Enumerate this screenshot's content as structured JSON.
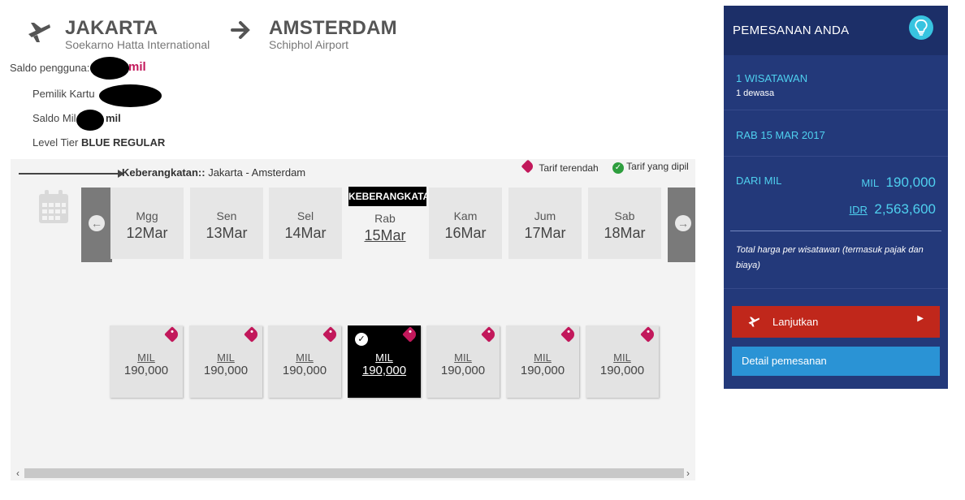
{
  "route": {
    "origin_city": "JAKARTA",
    "origin_airport": "Soekarno Hatta International",
    "dest_city": "AMSTERDAM",
    "dest_airport": "Schiphol Airport"
  },
  "user": {
    "saldo_label": "Saldo pengguna:",
    "saldo_unit": "mil",
    "card_owner_label": "Pemilik Kartu",
    "miles_label": "Saldo Mil",
    "miles_unit": "mil",
    "tier_label": "Level Tier",
    "tier_value": "BLUE REGULAR"
  },
  "panel": {
    "direction_label": "Keberangkatan::",
    "direction_route": "Jakarta - Amsterdam",
    "legend_lowest": "Tarif terendah",
    "legend_selected": "Tarif yang dipil",
    "tooltip": "KEBERANGKATAN",
    "days": [
      {
        "name": "Mgg",
        "date": "12Mar"
      },
      {
        "name": "Sen",
        "date": "13Mar"
      },
      {
        "name": "Sel",
        "date": "14Mar"
      },
      {
        "name": "Rab",
        "date": "15Mar"
      },
      {
        "name": "Kam",
        "date": "16Mar"
      },
      {
        "name": "Jum",
        "date": "17Mar"
      },
      {
        "name": "Sab",
        "date": "18Mar"
      }
    ],
    "fares": [
      {
        "currency": "MIL",
        "amount": "190,000"
      },
      {
        "currency": "MIL",
        "amount": "190,000"
      },
      {
        "currency": "MIL",
        "amount": "190,000"
      },
      {
        "currency": "MIL",
        "amount": "190,000"
      },
      {
        "currency": "MIL",
        "amount": "190,000"
      },
      {
        "currency": "MIL",
        "amount": "190,000"
      },
      {
        "currency": "MIL",
        "amount": "190,000"
      }
    ],
    "selected_index": 3
  },
  "sidebar": {
    "title": "PEMESANAN ANDA",
    "travelers": "1 WISATAWAN",
    "travelers_detail": "1 dewasa",
    "date": "RAB 15 MAR 2017",
    "from_label": "DARI MIL",
    "mil_cur": "MIL",
    "mil_amount": "190,000",
    "idr_cur": "IDR",
    "idr_amount": "2,563,600",
    "note": "Total harga per wisatawan (termasuk pajak dan biaya)",
    "continue_label": "Lanjutkan",
    "details_label": "Detail pemesanan"
  },
  "colors": {
    "sidebar_bg": "#23397a",
    "accent_cyan": "#4fd0ef",
    "continue_red": "#c0271b",
    "details_blue": "#2a93d5",
    "lowest_tag": "#c2185b"
  }
}
